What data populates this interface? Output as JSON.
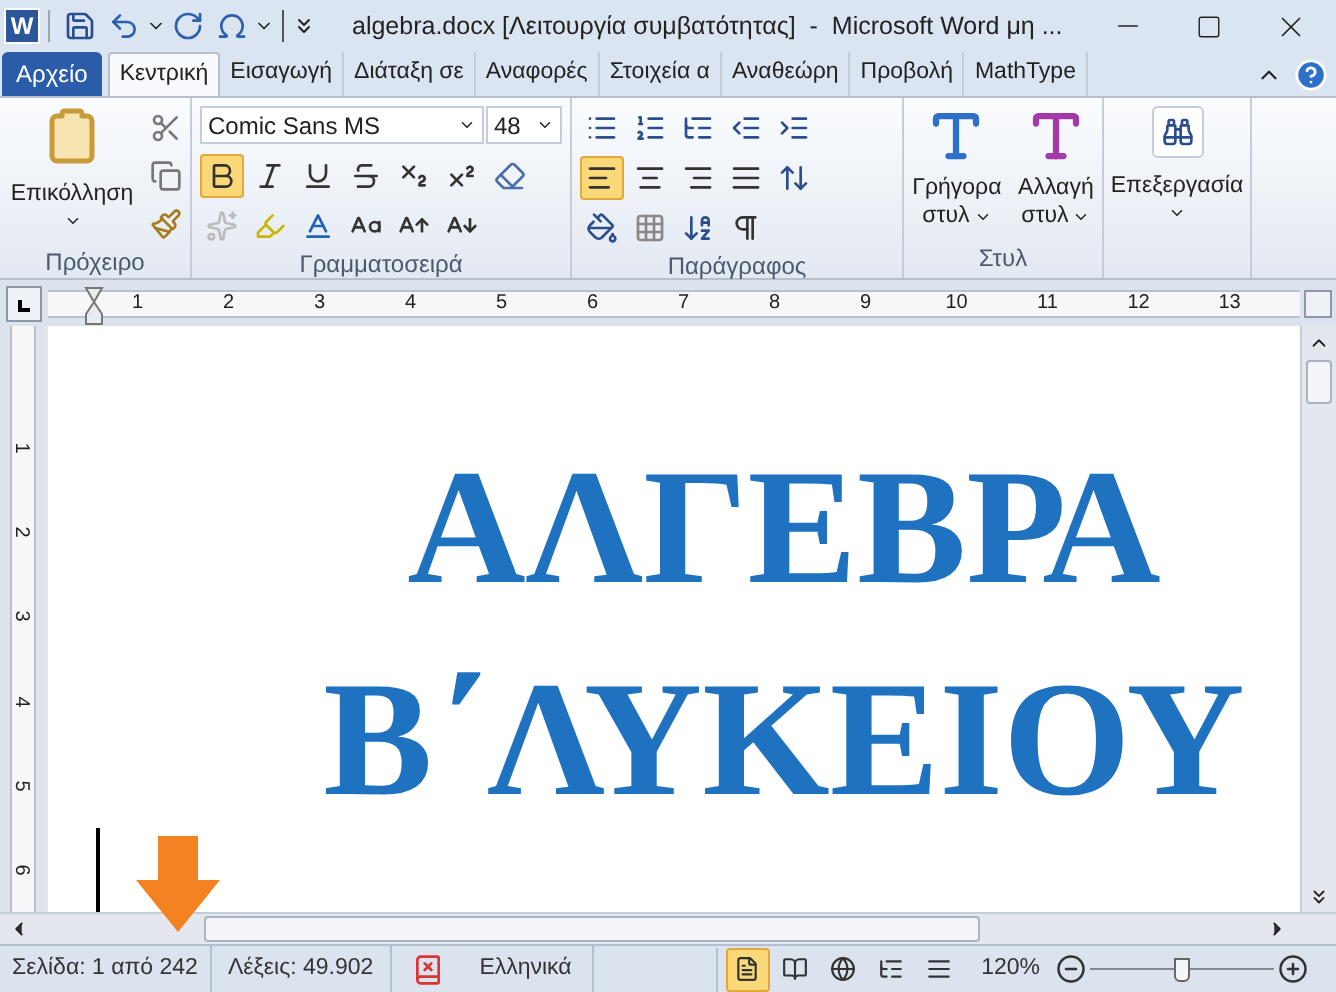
{
  "window": {
    "logo": "W",
    "title": "algebra.docx [Λειτουργία συμβατότητας]  -  Microsoft Word μη ..."
  },
  "file_tab": {
    "label": "Αρχείο"
  },
  "tabs": [
    {
      "label": "Κεντρική",
      "selected": true
    },
    {
      "label": "Εισαγωγή",
      "selected": false
    },
    {
      "label": "Διάταξη σε",
      "selected": false
    },
    {
      "label": "Αναφορές",
      "selected": false
    },
    {
      "label": "Στοιχεία α",
      "selected": false
    },
    {
      "label": "Αναθεώρη",
      "selected": false
    },
    {
      "label": "Προβολή",
      "selected": false
    },
    {
      "label": "MathType",
      "selected": false
    }
  ],
  "ribbon": {
    "clipboard": {
      "paste": "Επικόλληση",
      "label": "Πρόχειρο"
    },
    "font": {
      "name": "Comic Sans MS",
      "size": "48",
      "bold": true,
      "label": "Γραμματοσειρά"
    },
    "paragraph": {
      "alignments": [
        {
          "selected": true
        },
        {
          "selected": false
        },
        {
          "selected": false
        },
        {
          "selected": false
        }
      ],
      "label": "Παράγραφος"
    },
    "styles": {
      "buttons": [
        {
          "line1": "Γρήγορα",
          "line2": "στυλ"
        },
        {
          "line1": "Αλλαγή",
          "line2": "στυλ"
        }
      ],
      "label": "Στυλ"
    },
    "editing": {
      "label": "Επεξεργασία"
    }
  },
  "ruler": {
    "horizontal": [
      "1",
      "2",
      "3",
      "4",
      "5",
      "6",
      "7",
      "8",
      "9",
      "10",
      "11",
      "12",
      "13"
    ],
    "vertical": [
      "1",
      "2",
      "3",
      "4",
      "5",
      "6"
    ]
  },
  "document": {
    "lines": [
      "ΑΛΓΕΒΡΑ",
      "Β΄ΛΥΚΕΙΟΥ"
    ]
  },
  "status_bar": {
    "page": "Σελίδα: 1 από 242",
    "words": "Λέξεις: 49.902",
    "language": "Ελληνικά",
    "views": [
      {
        "selected": true
      },
      {
        "selected": false
      },
      {
        "selected": false
      },
      {
        "selected": false
      },
      {
        "selected": false
      }
    ],
    "zoom": "120%",
    "zoom_slider": {
      "level": 0.5
    }
  }
}
